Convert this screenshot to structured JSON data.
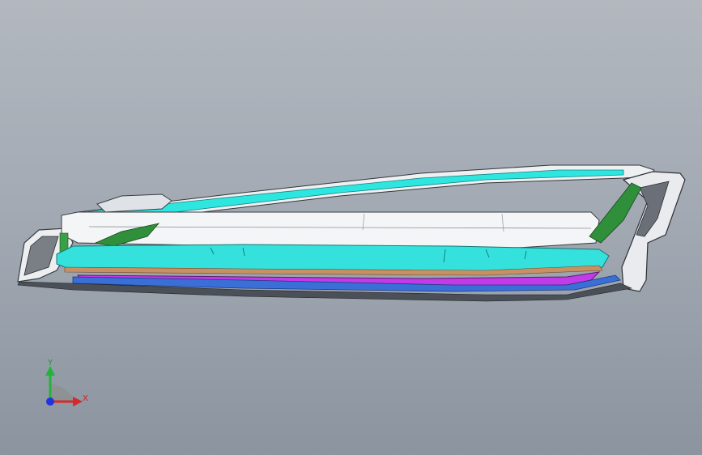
{
  "viewport": {
    "background_top": "#b3b8bf",
    "background_bottom": "#8b949f"
  },
  "model": {
    "colors": {
      "cyan": "#2ee6e0",
      "magenta": "#c23be8",
      "green": "#2f8f3a",
      "white": "#f2f3f5",
      "blue": "#3a6fd8",
      "gray": "#5e636b"
    }
  },
  "triad": {
    "x_label": "X",
    "y_label": "Y",
    "x_color": "#d42a2a",
    "y_color": "#22b33a",
    "z_color": "#2233dd"
  }
}
